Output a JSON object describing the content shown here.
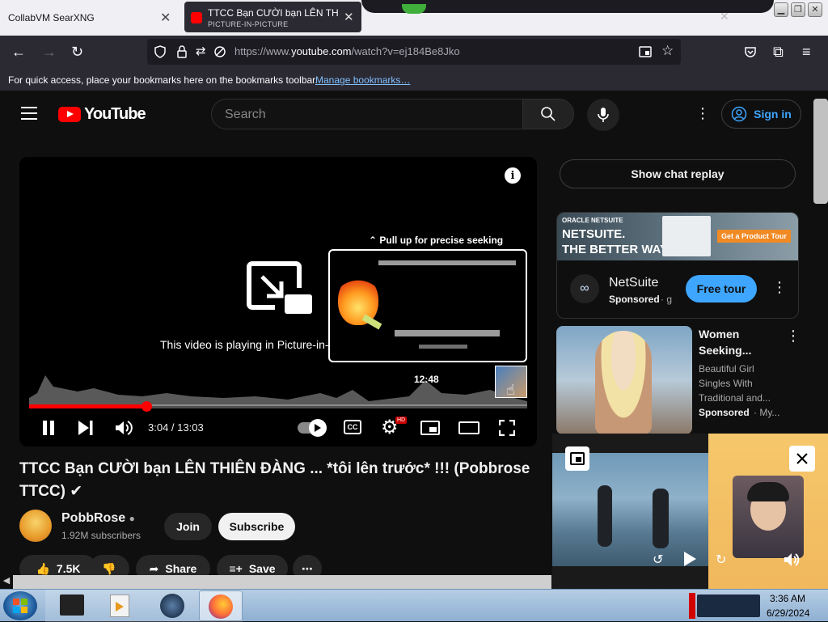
{
  "browser": {
    "tabs": [
      {
        "label": "CollabVM SearXNG",
        "active": false
      },
      {
        "label": "TTCC Bạn CƯỜI bạn LÊN THIÊN",
        "sub": "PICTURE-IN-PICTURE",
        "active": true
      }
    ],
    "url_prefix": "https://www.",
    "url_domain": "youtube.com",
    "url_path": "/watch?v=ej184Be8Jko",
    "bookmarks_text": "For quick access, place your bookmarks here on the bookmarks toolbar.",
    "bookmarks_link": "Manage bookmarks…"
  },
  "youtube": {
    "logo_text": "YouTube",
    "search_placeholder": "Search",
    "sign_in": "Sign in"
  },
  "player": {
    "pip_message": "This video is playing in Picture-in-",
    "pull_up": "Pull up for precise seeking",
    "preview_time": "12:48",
    "time": "3:04 / 13:03",
    "progress_fraction": 0.236,
    "hd_badge": "HD",
    "cc_label": "CC"
  },
  "video": {
    "title": "TTCC Bạn CƯỜI bạn LÊN THIÊN ĐÀNG ... *tôi lên trước* !!! (Pobbrose TTCC) ✔",
    "channel": "PobbRose",
    "subscribers": "1.92M subscribers",
    "join": "Join",
    "subscribe": "Subscribe",
    "likes": "7.5K",
    "share": "Share",
    "save": "Save"
  },
  "sidebar": {
    "chat_replay": "Show chat replay",
    "ad": {
      "banner_brand": "ORACLE NETSUITE",
      "banner_line1": "NETSUITE.",
      "banner_line2": "THE BETTER WAY",
      "banner_cta": "Get a Product Tour",
      "advertiser": "NetSuite",
      "sponsored": "Sponsored",
      "sponsored_suffix": "· g",
      "cta": "Free tour"
    },
    "video2": {
      "title_line1": "Women",
      "title_line2": "Seeking...",
      "desc1": "Beautiful Girl",
      "desc2": "Singles With",
      "desc3": "Traditional and...",
      "sponsored": "Sponsored",
      "suffix": "· My..."
    }
  },
  "taskbar": {
    "time": "3:36 AM",
    "date": "6/29/2024"
  },
  "colors": {
    "yt_red": "#ff0000",
    "link_blue": "#3ea6ff",
    "taskbar": "#9fbcd9"
  }
}
